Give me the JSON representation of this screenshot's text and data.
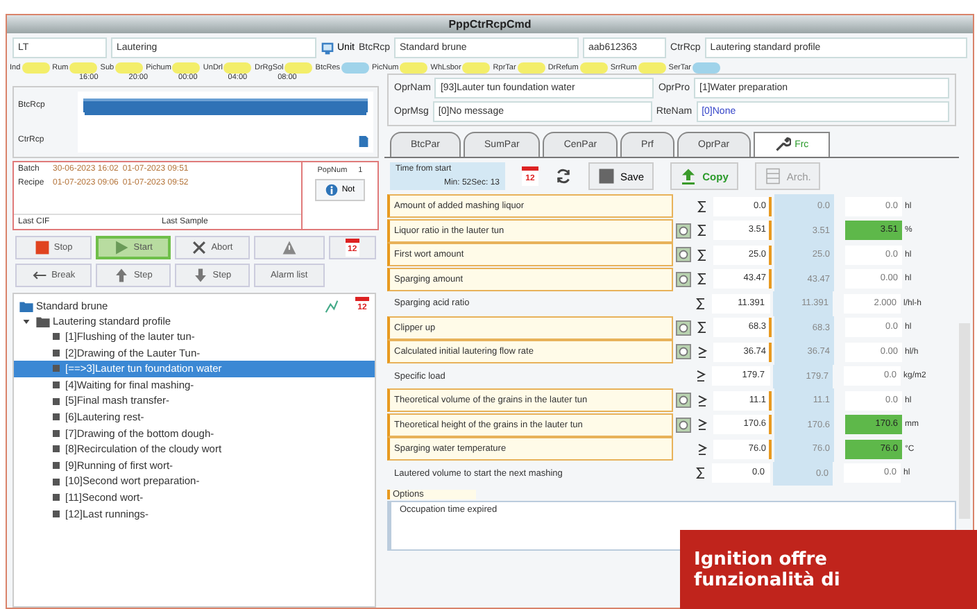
{
  "window": {
    "title": "PppCtrRcpCmd"
  },
  "header": {
    "unit_code": "LT",
    "unit_name": "Lautering",
    "unit_button": "Unit",
    "btc_label": "BtcRcp",
    "btc_value": "Standard brune",
    "batch_id": "aab612363",
    "ctr_label": "CtrRcp",
    "ctr_value": "Lautering standard profile"
  },
  "chips": [
    {
      "label": "Ind",
      "color": "#f3ee6a"
    },
    {
      "label": "Rum",
      "color": "#f3ee6a"
    },
    {
      "label": "Sub",
      "color": "#f3ee6a"
    },
    {
      "label": "Pichum",
      "color": "#f3ee6a"
    },
    {
      "label": "UnDrl",
      "color": "#f3ee6a"
    },
    {
      "label": "DrRgSol",
      "color": "#f3ee6a"
    },
    {
      "label": "BtcRes",
      "color": "#9fd3ea"
    },
    {
      "label": "PicNum",
      "color": "#f3ee6a"
    },
    {
      "label": "WhLsbor",
      "color": "#f3ee6a"
    },
    {
      "label": "RprTar",
      "color": "#f3ee6a"
    },
    {
      "label": "DrRefum",
      "color": "#f3ee6a"
    },
    {
      "label": "SrrRum",
      "color": "#f3ee6a"
    },
    {
      "label": "SerTar",
      "color": "#9fd3ea"
    }
  ],
  "timeline": {
    "times": [
      "16:00",
      "20:00",
      "00:00",
      "04:00",
      "08:00"
    ],
    "rows": [
      "BtcRcp",
      "CtrRcp"
    ]
  },
  "operation": {
    "opr_nam_label": "OprNam",
    "opr_nam": "[93]Lauter tun foundation water",
    "opr_msg_label": "OprMsg",
    "opr_msg": "[0]No message",
    "opr_pro_label": "OprPro",
    "opr_pro": "[1]Water preparation",
    "rte_nam_label": "RteNam",
    "rte_nam": "[0]None"
  },
  "batch": {
    "rows": [
      {
        "label": "Batch",
        "start": "30-06-2023 16:02",
        "end": "01-07-2023 09:51"
      },
      {
        "label": "Recipe",
        "start": "01-07-2023 09:06",
        "end": "01-07-2023 09:52"
      }
    ],
    "last_cif": "Last CIF",
    "last_sample": "Last Sample",
    "pop_label": "PopNum",
    "pop_value": "1",
    "info_button": "Not"
  },
  "commands": [
    {
      "kind": "stop",
      "label": "Stop",
      "selected": false
    },
    {
      "kind": "start",
      "label": "Start",
      "selected": true
    },
    {
      "kind": "abort",
      "label": "Abort",
      "selected": false
    },
    {
      "kind": "warning",
      "selected": false
    },
    {
      "kind": "calendar",
      "label": "12",
      "selected": false
    },
    {
      "kind": "break",
      "label": "Break",
      "selected": false
    },
    {
      "kind": "up",
      "label": "Step",
      "selected": false
    },
    {
      "kind": "down",
      "label": "Step",
      "selected": false
    },
    {
      "kind": "text",
      "label": "Alarm list",
      "selected": false
    }
  ],
  "tree": {
    "label": "Standard brune",
    "expanded": true,
    "calendar": "12",
    "children": [
      {
        "label": "Lautering standard profile",
        "expanded": true,
        "children": [
          {
            "label": "[1]Flushing of the lauter tun-",
            "selected": false
          },
          {
            "label": "[2]Drawing of the Lauter Tun-",
            "selected": false
          },
          {
            "label": "[==>3]Lauter tun foundation water",
            "selected": true
          },
          {
            "label": "[4]Waiting for final mashing-",
            "selected": false
          },
          {
            "label": "[5]Final mash transfer-",
            "selected": false
          },
          {
            "label": "[6]Lautering rest-",
            "selected": false
          },
          {
            "label": "[7]Drawing of the bottom dough-",
            "selected": false
          },
          {
            "label": "[8]Recirculation of the cloudy wort",
            "selected": false
          },
          {
            "label": "[9]Running of first wort-",
            "selected": false
          },
          {
            "label": "[10]Second wort preparation-",
            "selected": false
          },
          {
            "label": "[11]Second wort-",
            "selected": false
          },
          {
            "label": "[12]Last runnings-",
            "selected": false
          }
        ]
      }
    ]
  },
  "tabs": [
    {
      "label": "BtcPar",
      "selected": false
    },
    {
      "label": "SumPar",
      "selected": false
    },
    {
      "label": "CenPar",
      "selected": false
    },
    {
      "label": "Prf",
      "selected": false
    },
    {
      "label": "OprPar",
      "selected": false
    },
    {
      "label": "Frc",
      "selected": true
    }
  ],
  "toolbar": {
    "time_label": "Time from start",
    "time_value": "Min: 52Sec: 13",
    "calendar": "12",
    "save": "Save",
    "copy": "Copy",
    "arch": "Arch."
  },
  "parameters": [
    {
      "name": "Amount of added mashing liquor",
      "kind": "sum",
      "flagged": true,
      "icon": false,
      "value": "0.0",
      "setpoint": "0.0",
      "limit": "0.0",
      "limit_reached": false,
      "unit": "hl"
    },
    {
      "name": "Liquor ratio in the lauter tun",
      "kind": "sum",
      "flagged": true,
      "icon": true,
      "value": "3.51",
      "setpoint": "3.51",
      "limit": "3.51",
      "limit_reached": true,
      "unit": "%"
    },
    {
      "name": "First wort amount",
      "kind": "sum",
      "flagged": true,
      "icon": true,
      "value": "25.0",
      "setpoint": "25.0",
      "limit": "0.0",
      "limit_reached": false,
      "unit": "hl"
    },
    {
      "name": "Sparging amount",
      "kind": "sum",
      "flagged": true,
      "icon": true,
      "value": "43.47",
      "setpoint": "43.47",
      "limit": "0.00",
      "limit_reached": false,
      "unit": "hl"
    },
    {
      "name": "Sparging acid ratio",
      "kind": "sum",
      "flagged": false,
      "icon": false,
      "value": "11.391",
      "setpoint": "11.391",
      "limit": "2.000",
      "limit_reached": false,
      "unit": "l/hl-h"
    },
    {
      "name": "Clipper up",
      "kind": "sum",
      "flagged": true,
      "icon": true,
      "value": "68.3",
      "setpoint": "68.3",
      "limit": "0.0",
      "limit_reached": false,
      "unit": "hl"
    },
    {
      "name": "Calculated initial lautering flow rate",
      "kind": "ge",
      "flagged": true,
      "icon": true,
      "value": "36.74",
      "setpoint": "36.74",
      "limit": "0.00",
      "limit_reached": false,
      "unit": "hl/h"
    },
    {
      "name": "Specific load",
      "kind": "ge",
      "flagged": false,
      "icon": false,
      "value": "179.7",
      "setpoint": "179.7",
      "limit": "0.0",
      "limit_reached": false,
      "unit": "kg/m2"
    },
    {
      "name": "Theoretical volume of the grains in the lauter tun",
      "kind": "ge",
      "flagged": true,
      "icon": true,
      "value": "11.1",
      "setpoint": "11.1",
      "limit": "0.0",
      "limit_reached": false,
      "unit": "hl"
    },
    {
      "name": "Theoretical height of the grains in the lauter tun",
      "kind": "ge",
      "flagged": true,
      "icon": true,
      "value": "170.6",
      "setpoint": "170.6",
      "limit": "170.6",
      "limit_reached": true,
      "unit": "mm"
    },
    {
      "name": "Sparging water temperature",
      "kind": "ge",
      "flagged": true,
      "icon": false,
      "value": "76.0",
      "setpoint": "76.0",
      "limit": "76.0",
      "limit_reached": true,
      "unit": "°C"
    },
    {
      "name": "Lautered volume to start the next mashing",
      "kind": "sum",
      "flagged": false,
      "icon": false,
      "value": "0.0",
      "setpoint": "0.0",
      "limit": "0.0",
      "limit_reached": false,
      "unit": "hl"
    }
  ],
  "options": {
    "label": "Options",
    "items": [
      "Occupation time expired"
    ]
  },
  "caption": {
    "text": "Ignition offre funzionalità di"
  }
}
